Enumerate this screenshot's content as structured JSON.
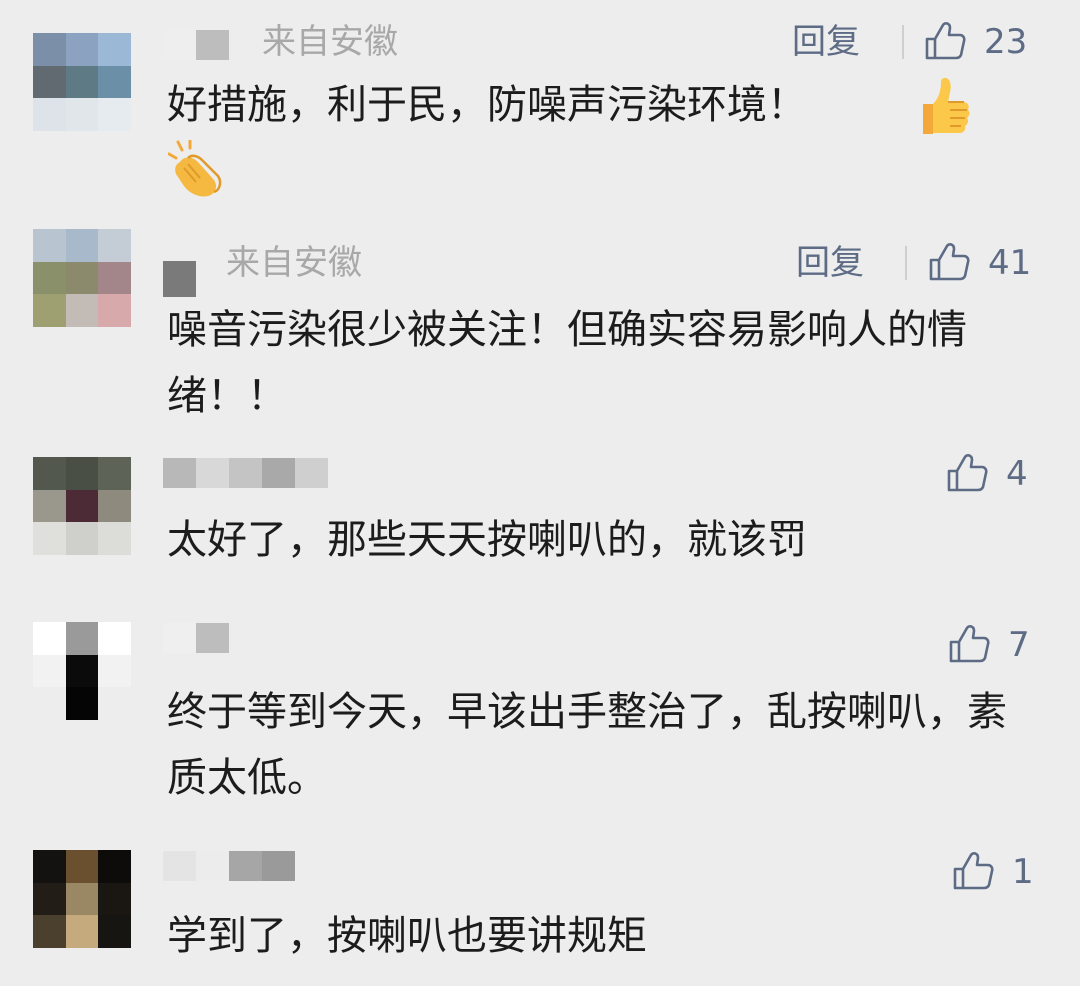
{
  "comments": [
    {
      "location": "来自安徽",
      "reply_label": "回复",
      "like_count": "23",
      "text": "好措施，利于民，防噪声污染环境！",
      "emojis": [
        "thumbs-up",
        "clapping-hands"
      ],
      "avatar_colors": [
        "#7c8fa9",
        "#8ba3c1",
        "#9bb8d6",
        "#606a70",
        "#5e7a84",
        "#6b8fa6",
        "#dde3e8",
        "#e1e6eb",
        "#e6ebef"
      ]
    },
    {
      "location": "来自安徽",
      "reply_label": "回复",
      "like_count": "41",
      "text": "噪音污染很少被关注！但确实容易影响人的情绪！！",
      "emojis": [],
      "avatar_colors": [
        "#b8c4cf",
        "#a9b9cc",
        "#c4cdd6",
        "#8a9069",
        "#8b8a6d",
        "#a3868a",
        "#9fa072",
        "#c3bcb6",
        "#d8a9aa"
      ]
    },
    {
      "location": "",
      "reply_label": "",
      "like_count": "4",
      "text": "太好了，那些天天按喇叭的，就该罚",
      "emojis": [],
      "avatar_colors": [
        "#52584e",
        "#4a4f45",
        "#5d6357",
        "#9a978c",
        "#4d2b36",
        "#8f8a7e",
        "#dfdfdb",
        "#cfcfcb",
        "#dcdcd8"
      ]
    },
    {
      "location": "",
      "reply_label": "",
      "like_count": "7",
      "text": "终于等到今天，早该出手整治了，乱按喇叭，素质太低。",
      "emojis": [],
      "avatar_colors": [
        "#ffffff",
        "#9a9a9a",
        "#ffffff",
        "#f2f2f2",
        "#0b0b0b",
        "#f2f2f2",
        "#ededed",
        "#050505",
        "#ededed"
      ]
    },
    {
      "location": "",
      "reply_label": "",
      "like_count": "1",
      "text": "学到了，按喇叭也要讲规矩",
      "emojis": [],
      "avatar_colors": [
        "#141210",
        "#6b5030",
        "#0d0c0b",
        "#221d16",
        "#9a8865",
        "#1a1712",
        "#4b402d",
        "#c4aa7d",
        "#171512"
      ]
    }
  ]
}
